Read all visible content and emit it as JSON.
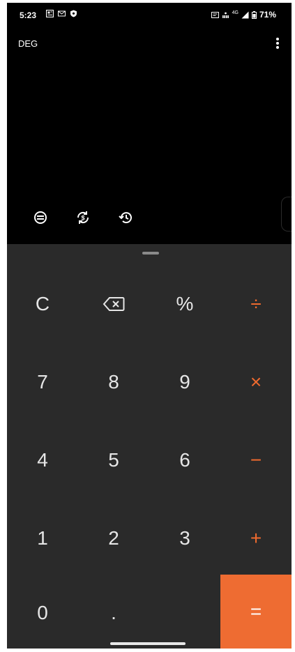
{
  "status_bar": {
    "time": "5:23",
    "left_icons": [
      "news-icon",
      "mail-icon",
      "shield-icon"
    ],
    "right_icons": [
      "cast-icon",
      "hotspot-icon",
      "wifi-icon",
      "signal-icon",
      "battery-icon"
    ],
    "signal_label": "4G",
    "battery": "71%"
  },
  "display": {
    "angle_mode": "DEG",
    "menu_icon": "more-vert-icon"
  },
  "modes": [
    {
      "name": "scientific",
      "icon": "scientific-mode-icon"
    },
    {
      "name": "currency",
      "icon": "currency-convert-icon"
    },
    {
      "name": "history",
      "icon": "history-icon"
    }
  ],
  "keys": {
    "clear": "C",
    "backspace_icon": "backspace-icon",
    "percent": "%",
    "divide": "÷",
    "seven": "7",
    "eight": "8",
    "nine": "9",
    "multiply": "×",
    "four": "4",
    "five": "5",
    "six": "6",
    "minus": "−",
    "one": "1",
    "two": "2",
    "three": "3",
    "plus": "+",
    "zero": "0",
    "decimal": ".",
    "equals": "="
  },
  "colors": {
    "background": "#000000",
    "keypad": "#2a2a2a",
    "accent": "#ef6a2e",
    "key_text": "#e6e6e6"
  }
}
